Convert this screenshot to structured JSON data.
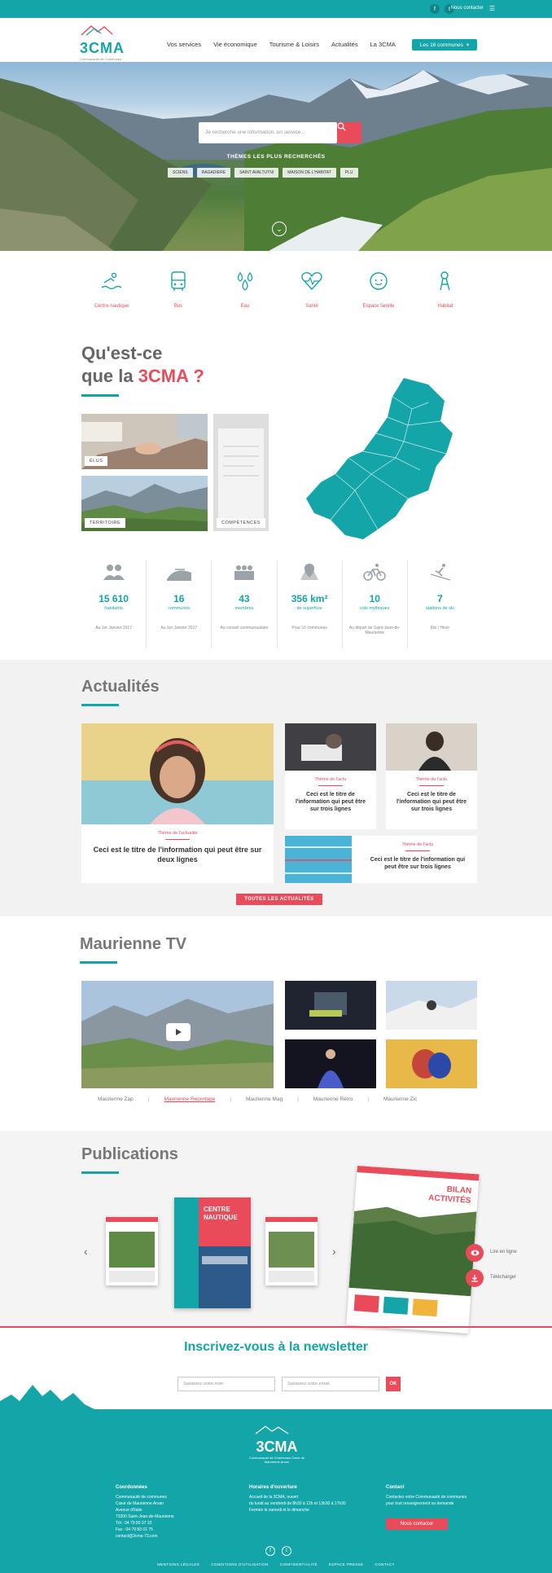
{
  "topbar": {
    "contact": "Nous contacter",
    "facebook": "f",
    "twitter": "t",
    "menu": "☰"
  },
  "header": {
    "logo_text": "3CMA",
    "logo_sub": "Communauté de Communes Cœur de Maurienne Arvan",
    "nav": [
      "Vos services",
      "Vie économique",
      "Tourisme & Loisirs",
      "Actualités",
      "La 3CMA"
    ],
    "cta": "Les 16 communes"
  },
  "hero": {
    "search_placeholder": "Je recherche une information, un service...",
    "search_icon": "search-icon",
    "popular_title": "THÈMES LES PLUS RECHERCHÉS",
    "tags": [
      "SCIENS",
      "RAGADIERE",
      "SAINT AVALTUTNI",
      "MAISON DE L'HABITAT",
      "PLU"
    ]
  },
  "services": [
    {
      "label": "Centre nautique",
      "icon": "swimmer-icon"
    },
    {
      "label": "Bus",
      "icon": "bus-icon"
    },
    {
      "label": "Eau",
      "icon": "water-drops-icon"
    },
    {
      "label": "Santé",
      "icon": "heart-icon"
    },
    {
      "label": "Espace famille",
      "icon": "baby-face-icon"
    },
    {
      "label": "Habitat",
      "icon": "habitat-icon"
    }
  ],
  "about": {
    "title_line1": "Qu'est-ce",
    "title_line2_prefix": "que la ",
    "title_line2_accent": "3CMA ?",
    "tiles": [
      "ÉLUS",
      "TERRITOIRE",
      "COMPÉTENCES"
    ]
  },
  "stats": [
    {
      "icon": "people-icon",
      "num": "15 610",
      "unit": "habitants",
      "note": "Au 1er Janvier 2017"
    },
    {
      "icon": "hills-icon",
      "num": "16",
      "unit": "communes",
      "note": "Au 1er Janvier 2017"
    },
    {
      "icon": "employees-icon",
      "num": "43",
      "unit": "membres",
      "note": "Au conseil communautaire"
    },
    {
      "icon": "map-pin-icon",
      "num": "356 km²",
      "unit": "de superficie",
      "note": "Pour 16 communes"
    },
    {
      "icon": "cyclist-icon",
      "num": "10",
      "unit": "cols mythiques",
      "note": "Au départ de Saint-Jean-de-Maurienne"
    },
    {
      "icon": "skier-icon",
      "num": "7",
      "unit": "stations de ski",
      "note": "Été / Hiver"
    }
  ],
  "news": {
    "title": "Actualités",
    "featured": {
      "theme": "Thème de l'actualité",
      "title": "Ceci est le titre de l'information qui peut être sur deux lignes"
    },
    "cards": [
      {
        "theme": "Thème de l'actu",
        "title": "Ceci est le titre de l'information qui peut être sur trois lignes"
      },
      {
        "theme": "Thème de l'actu",
        "title": "Ceci est le titre de l'information qui peut être sur trois lignes"
      },
      {
        "theme": "Thème de l'actu",
        "title": "Ceci est le titre de l'information qui peut être sur trois lignes"
      }
    ],
    "all_button": "TOUTES LES ACTUALITÉS"
  },
  "tv": {
    "title": "Maurienne TV",
    "tabs": [
      "Maurienne Zap",
      "Maurienne Reportage",
      "Maurienne Mag",
      "Maurienne Rétro",
      "Maurienne Zic"
    ],
    "active_tab": "Maurienne Reportage",
    "separator": "|"
  },
  "publications": {
    "title": "Publications",
    "book_title": "CENTRE NAUTIQUE",
    "report_title1": "BILAN",
    "report_title2": "ACTIVITÉS",
    "read_label": "Lire en ligne",
    "download_label": "Télécharger",
    "prev": "‹",
    "next": "›"
  },
  "newsletter": {
    "title": "Inscrivez-vous à la newsletter",
    "first_placeholder": "Saisissez votre nom",
    "second_placeholder": "Saisissez votre email",
    "ok": "OK"
  },
  "footer": {
    "logo_text": "3CMA",
    "logo_sub": "Communauté de Communes Cœur de Maurienne Arvan",
    "col1_title": "Coordonnées",
    "col1_lines": [
      "Communauté de communes",
      "Cœur de Maurienne Arvan",
      "",
      "Avenue d'Italie",
      "73300 Saint-Jean-de-Maurienne",
      "",
      "Tél : 04 79 83 07 32",
      "Fax : 04 79 83 01 75",
      "contact@3cma-73.com"
    ],
    "col2_title": "Horaires d'ouverture",
    "col2_lines": [
      "Accueil de la 3CMA, ouvert",
      "du lundi au vendredi de 8h30 à 12h et 13h30 à 17h30",
      "Fermée le samedi et le dimanche"
    ],
    "col3_title": "Contact",
    "col3_lines": [
      "Contactez votre Communauté de communes",
      "pour tout renseignement ou demande"
    ],
    "contact_button": "Nous contacter",
    "links": [
      "MENTIONS LÉGALES",
      "CONDITIONS D'UTILISATION",
      "CONFIDENTIALITÉ",
      "ESPACE PRESSE",
      "CONTACT"
    ]
  },
  "colors": {
    "teal": "#13a5a7",
    "red": "#e94b5a",
    "grey_text": "#777777"
  }
}
